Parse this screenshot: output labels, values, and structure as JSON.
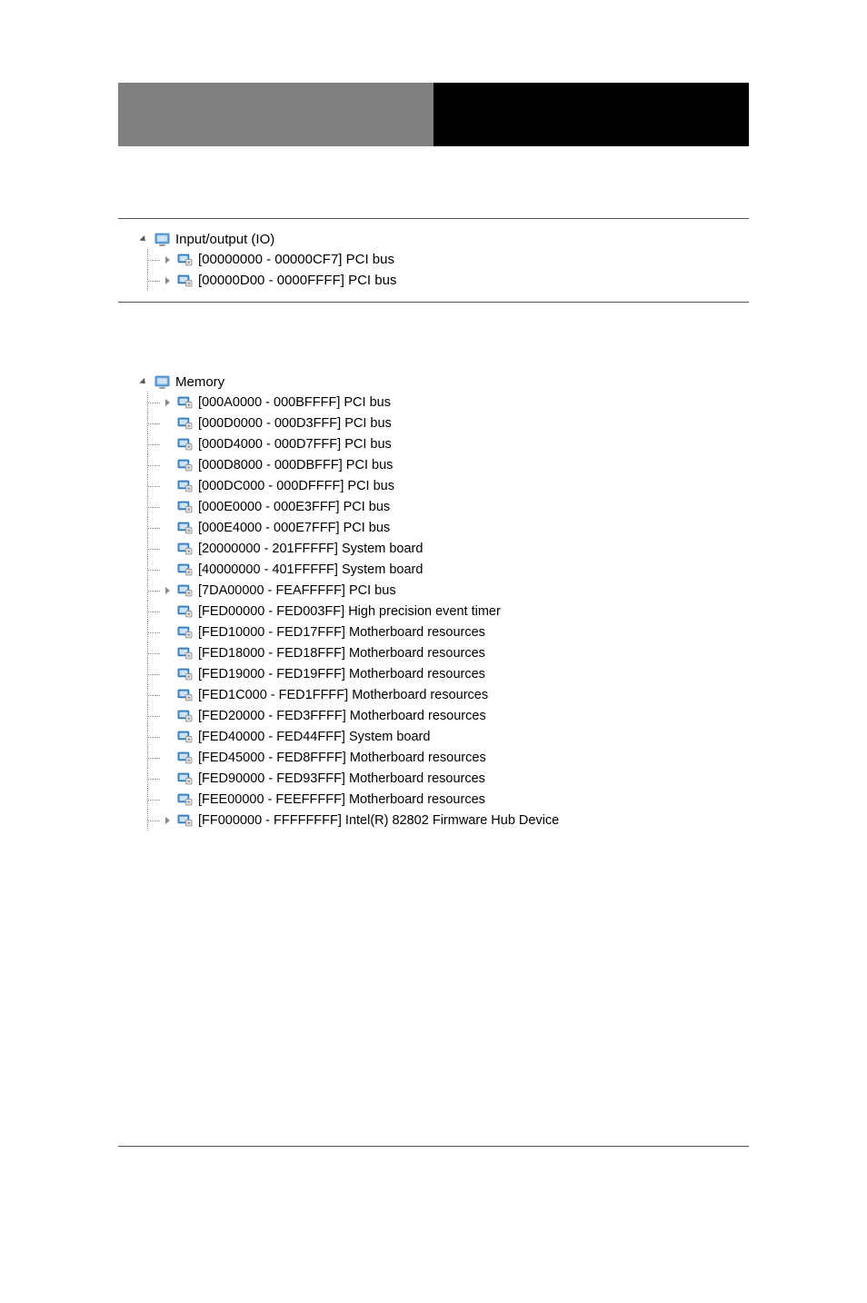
{
  "io": {
    "root": "Input/output (IO)",
    "items": [
      {
        "expandable": true,
        "range": "[00000000 - 00000CF7]",
        "name": "PCI bus"
      },
      {
        "expandable": true,
        "range": "[00000D00 - 0000FFFF]",
        "name": "PCI bus"
      }
    ]
  },
  "memory": {
    "root": "Memory",
    "items": [
      {
        "expandable": true,
        "range": "[000A0000 - 000BFFFF]",
        "name": "PCI bus"
      },
      {
        "expandable": false,
        "range": "[000D0000 - 000D3FFF]",
        "name": "PCI bus"
      },
      {
        "expandable": false,
        "range": "[000D4000 - 000D7FFF]",
        "name": "PCI bus"
      },
      {
        "expandable": false,
        "range": "[000D8000 - 000DBFFF]",
        "name": "PCI bus"
      },
      {
        "expandable": false,
        "range": "[000DC000 - 000DFFFF]",
        "name": "PCI bus"
      },
      {
        "expandable": false,
        "range": "[000E0000 - 000E3FFF]",
        "name": "PCI bus"
      },
      {
        "expandable": false,
        "range": "[000E4000 - 000E7FFF]",
        "name": "PCI bus"
      },
      {
        "expandable": false,
        "range": "[20000000 - 201FFFFF]",
        "name": "System board"
      },
      {
        "expandable": false,
        "range": "[40000000 - 401FFFFF]",
        "name": "System board"
      },
      {
        "expandable": true,
        "range": "[7DA00000 - FEAFFFFF]",
        "name": "PCI bus"
      },
      {
        "expandable": false,
        "range": "[FED00000 - FED003FF]",
        "name": "High precision event timer"
      },
      {
        "expandable": false,
        "range": "[FED10000 - FED17FFF]",
        "name": "Motherboard resources"
      },
      {
        "expandable": false,
        "range": "[FED18000 - FED18FFF]",
        "name": "Motherboard resources"
      },
      {
        "expandable": false,
        "range": "[FED19000 - FED19FFF]",
        "name": "Motherboard resources"
      },
      {
        "expandable": false,
        "range": "[FED1C000 - FED1FFFF]",
        "name": "Motherboard resources"
      },
      {
        "expandable": false,
        "range": "[FED20000 - FED3FFFF]",
        "name": "Motherboard resources"
      },
      {
        "expandable": false,
        "range": "[FED40000 - FED44FFF]",
        "name": "System board"
      },
      {
        "expandable": false,
        "range": "[FED45000 - FED8FFFF]",
        "name": "Motherboard resources"
      },
      {
        "expandable": false,
        "range": "[FED90000 - FED93FFF]",
        "name": "Motherboard resources"
      },
      {
        "expandable": false,
        "range": "[FEE00000 - FEEFFFFF]",
        "name": "Motherboard resources"
      },
      {
        "expandable": true,
        "range": "[FF000000 - FFFFFFFF]",
        "name": "Intel(R) 82802 Firmware Hub Device"
      }
    ]
  }
}
